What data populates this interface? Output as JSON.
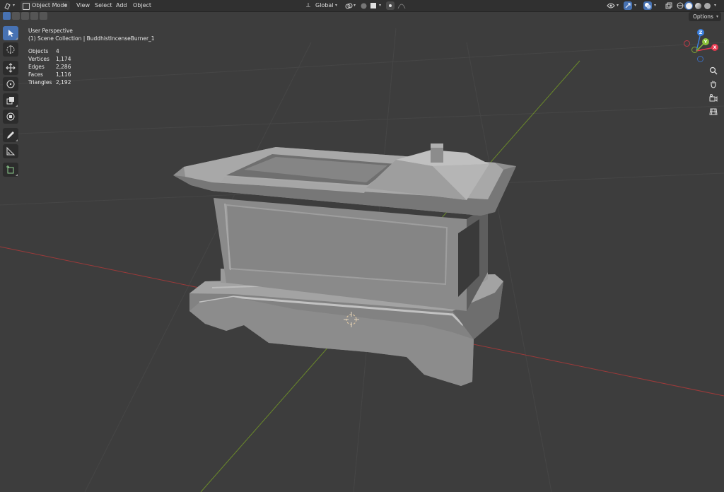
{
  "header": {
    "editor_type_icon": "view3d-icon",
    "mode_label": "Object Mode",
    "menus": [
      "View",
      "Select",
      "Add",
      "Object"
    ],
    "transform_orientation": "Global",
    "pivot_icon": "pivot-icon",
    "snap_icon": "magnet-icon",
    "proportional_icon": "proportional-edit-icon",
    "visibility_icon": "eye-icon",
    "gizmo_icon": "gizmo-icon",
    "overlay_icon": "overlay-icon",
    "xray_icon": "xray-icon",
    "shading_modes": [
      "wireframe",
      "solid",
      "material",
      "rendered"
    ]
  },
  "subheader": {
    "selection_modes": [
      "set",
      "extend",
      "subtract",
      "difference",
      "intersect"
    ],
    "options_label": "Options"
  },
  "toolbar": {
    "tools": [
      "select-box",
      "cursor",
      "move",
      "rotate",
      "scale",
      "transform",
      "annotate",
      "measure",
      "add-cube"
    ],
    "active": "select-box"
  },
  "overlay": {
    "view_name": "User Perspective",
    "collection_line": "(1) Scene Collection | BuddhistIncenseBurner_1",
    "stats": [
      {
        "label": "Objects",
        "value": "4"
      },
      {
        "label": "Vertices",
        "value": "1,174"
      },
      {
        "label": "Edges",
        "value": "2,286"
      },
      {
        "label": "Faces",
        "value": "1,116"
      },
      {
        "label": "Triangles",
        "value": "2,192"
      }
    ]
  },
  "gizmo": {
    "axes": {
      "x": "X",
      "y": "Y",
      "z": "Z"
    },
    "colors": {
      "x": "#e8384f",
      "y": "#8cc23a",
      "z": "#3b80e0"
    }
  },
  "nav_buttons": [
    "zoom-icon",
    "hand-icon",
    "camera-icon",
    "grid-icon"
  ],
  "colors": {
    "viewport_bg": "#3d3d3d",
    "header_bg": "#303030",
    "active_tool": "#4772b3",
    "x_axis_line": "#9c3a3a",
    "y_axis_line": "#6b8a2a"
  }
}
